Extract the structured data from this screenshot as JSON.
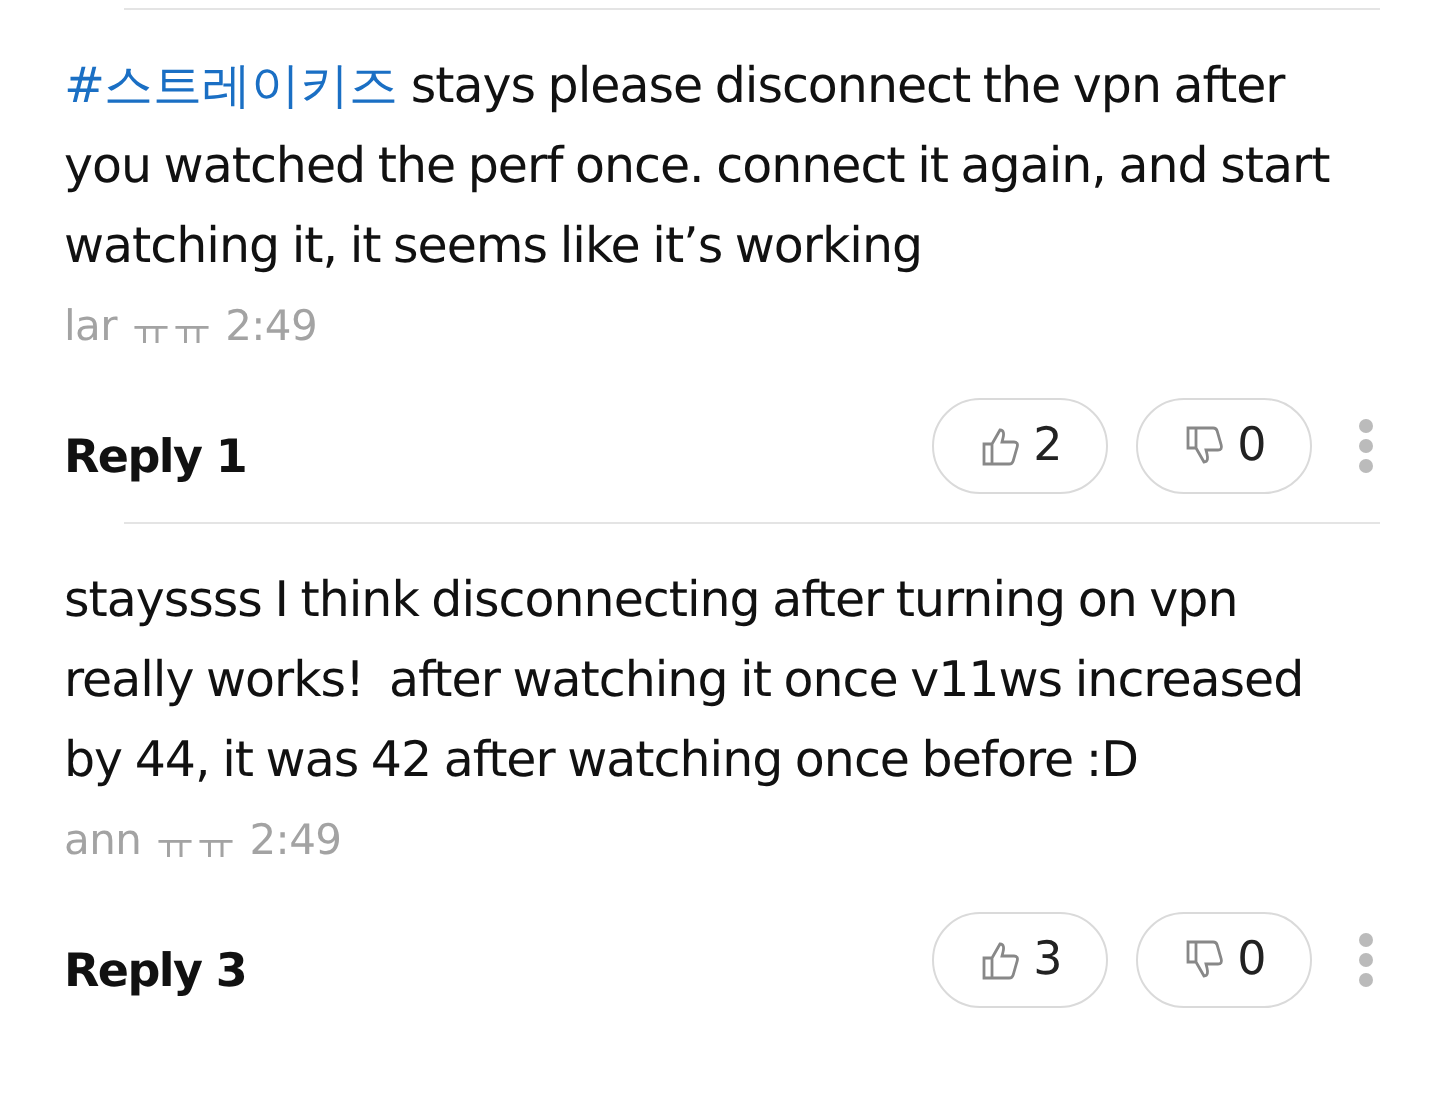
{
  "comments": [
    {
      "hashtag": "#스트레이키즈",
      "text": "stays please disconnect the vpn after you watched the perf once. connect it again, and start watching it, it seems like it’s working",
      "meta": "lar ㅠㅠ 2:49",
      "replies": "Reply 1",
      "likes": "2",
      "dislikes": "0"
    },
    {
      "text": "stayssss I think disconnecting after turning on vpn really works!  after watching it once v11ws increased by 44, it was 42 after watching once before :D",
      "meta": "ann ㅠㅠ 2:49",
      "replies": "Reply 3",
      "likes": "3",
      "dislikes": "0"
    }
  ]
}
